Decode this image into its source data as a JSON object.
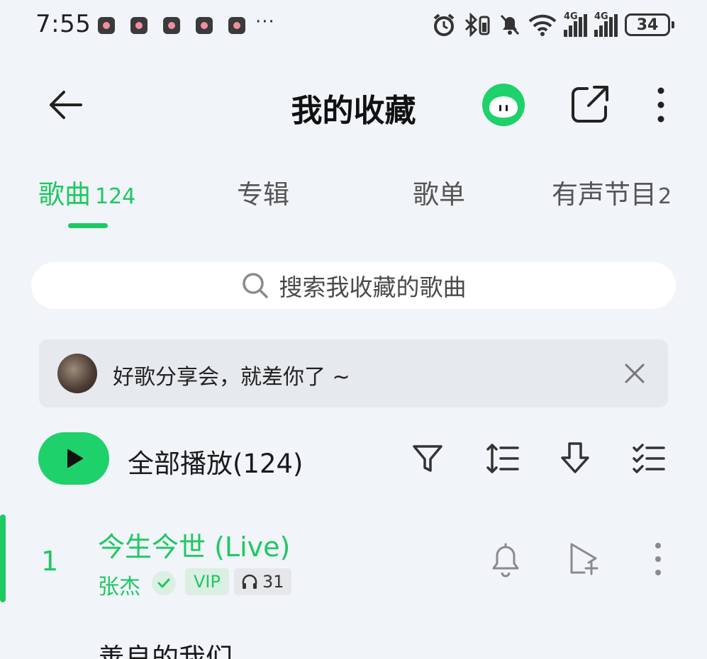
{
  "status_bar": {
    "time": "7:55",
    "overflow": "···",
    "battery": "34",
    "network_1": "4G",
    "network_2": "4G",
    "icons": [
      "alarm-icon",
      "bluetooth-icon",
      "mute-icon",
      "wifi-icon",
      "signal-icon",
      "signal-icon"
    ]
  },
  "header": {
    "title": "我的收藏",
    "icons": [
      "back-arrow-icon",
      "mascot-icon",
      "share-icon",
      "more-vertical-icon"
    ]
  },
  "tabs": [
    {
      "label": "歌曲",
      "count": "124",
      "active": true
    },
    {
      "label": "专辑",
      "count": ""
    },
    {
      "label": "歌单",
      "count": ""
    },
    {
      "label": "有声节目",
      "count": "2"
    }
  ],
  "search": {
    "placeholder": "搜索我收藏的歌曲"
  },
  "banner": {
    "text": "好歌分享会，就差你了 ~"
  },
  "toolbar": {
    "play_all_label": "全部播放(124)",
    "icons": [
      "filter-icon",
      "sort-icon",
      "download-icon",
      "multi-select-icon"
    ]
  },
  "songs": [
    {
      "index": "1",
      "title": "今生今世 (Live)",
      "artist": "张杰",
      "vip": "VIP",
      "listeners": "31",
      "playing": true
    },
    {
      "title": "善良的我们"
    }
  ],
  "colors": {
    "accent": "#1ec862",
    "background": "#f1f4f8"
  }
}
